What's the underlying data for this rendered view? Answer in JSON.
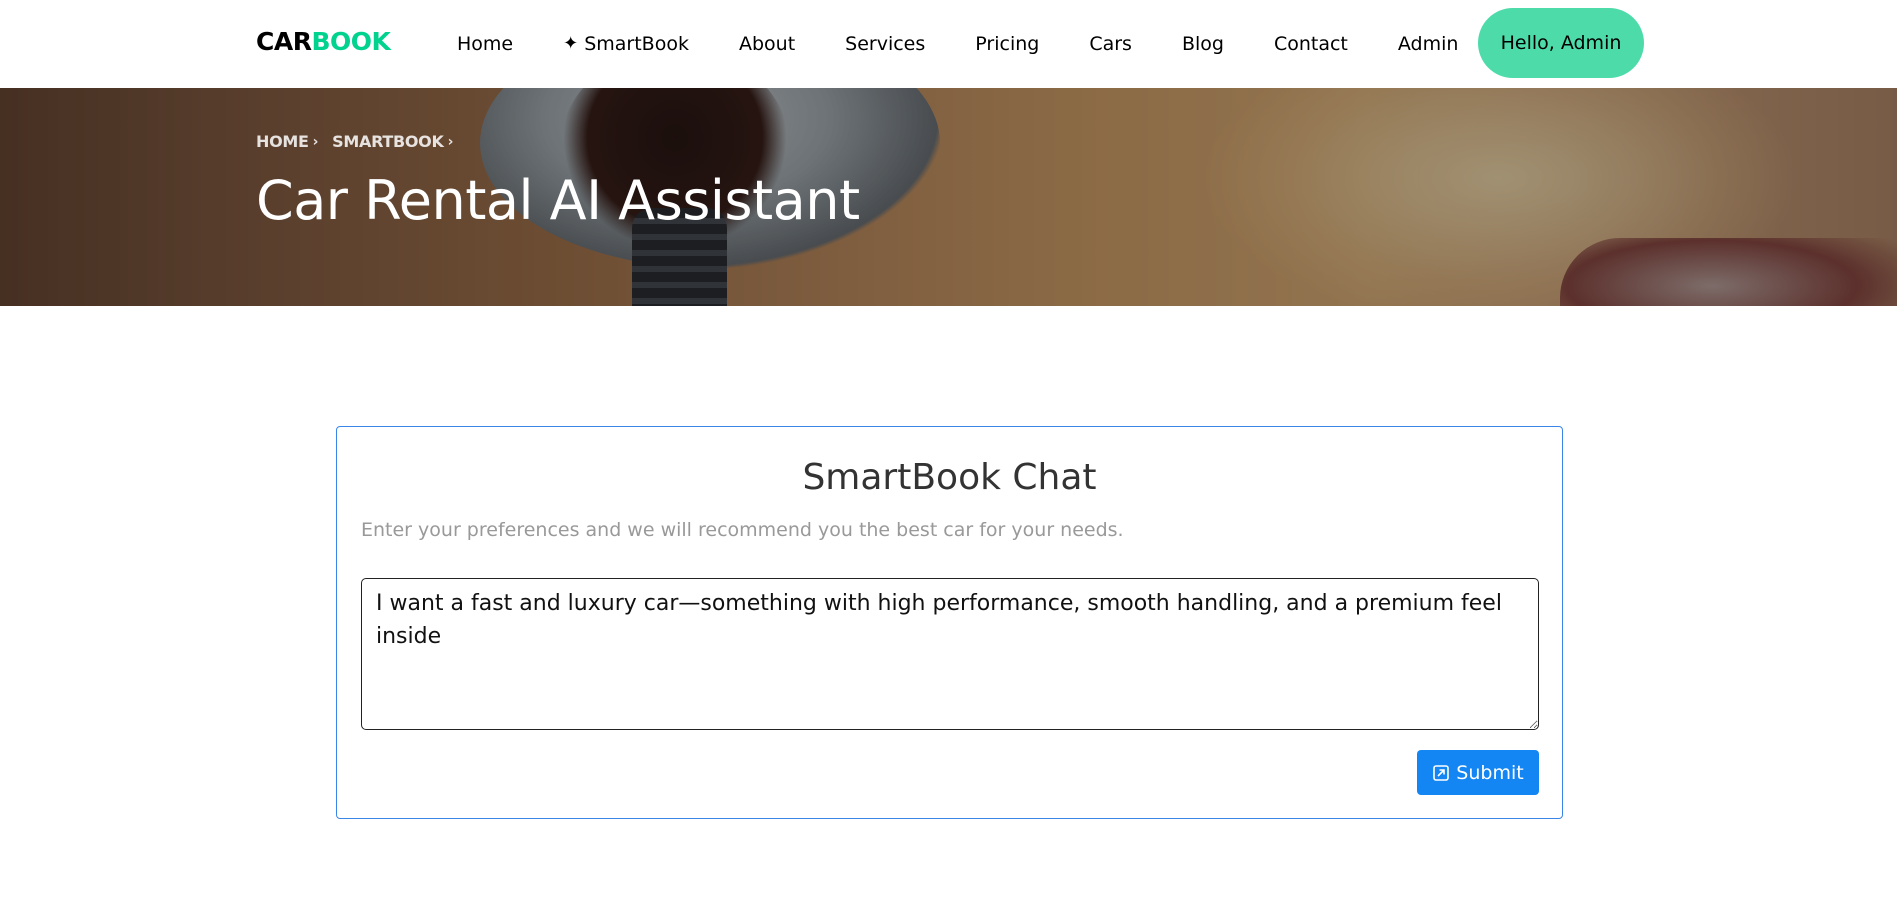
{
  "brand": {
    "part1": "CAR",
    "part2": "BOOK"
  },
  "nav": {
    "items": [
      {
        "label": "Home"
      },
      {
        "label": "SmartBook",
        "icon": "sparkle-icon"
      },
      {
        "label": "About"
      },
      {
        "label": "Services"
      },
      {
        "label": "Pricing"
      },
      {
        "label": "Cars"
      },
      {
        "label": "Blog"
      },
      {
        "label": "Contact"
      },
      {
        "label": "Admin"
      }
    ],
    "user_button": "Hello, Admin"
  },
  "hero": {
    "breadcrumb": [
      "HOME",
      "SMARTBOOK"
    ],
    "title": "Car Rental AI Assistant"
  },
  "chat": {
    "title": "SmartBook Chat",
    "subtitle": "Enter your preferences and we will recommend you the best car for your needs.",
    "input_value": "I want a fast and luxury car—something with high performance, smooth handling, and a premium feel inside",
    "submit_label": "Submit"
  },
  "colors": {
    "brand_green": "#01d28e",
    "user_button_bg": "#4ddbaa",
    "primary_blue": "#1386f3",
    "card_border": "#3a86e8"
  }
}
